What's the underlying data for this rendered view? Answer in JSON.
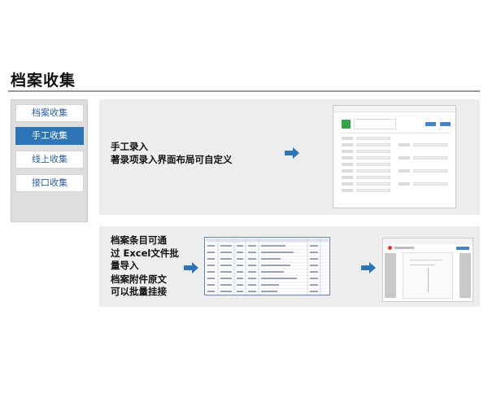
{
  "page": {
    "title": "档案收集"
  },
  "sidebar": {
    "items": [
      {
        "label": "档案收集",
        "active": false
      },
      {
        "label": "手工收集",
        "active": true
      },
      {
        "label": "线上收集",
        "active": false
      },
      {
        "label": "接口收集",
        "active": false
      }
    ]
  },
  "panel_manual": {
    "line1": "手工录入",
    "line2": "著录项录入界面布局可自定义"
  },
  "panel_import": {
    "line1": "档案条目可通",
    "line2": "过 Excel文件批",
    "line3": "量导入",
    "line4": "档案附件原文",
    "line5": "可以批量挂接"
  },
  "colors": {
    "accent": "#2e75b6",
    "panel_bg": "#ededed",
    "sidebar_bg": "#dedede"
  },
  "icons": [
    "right-arrow-icon",
    "form-app-icon",
    "pdf-app-icon"
  ]
}
